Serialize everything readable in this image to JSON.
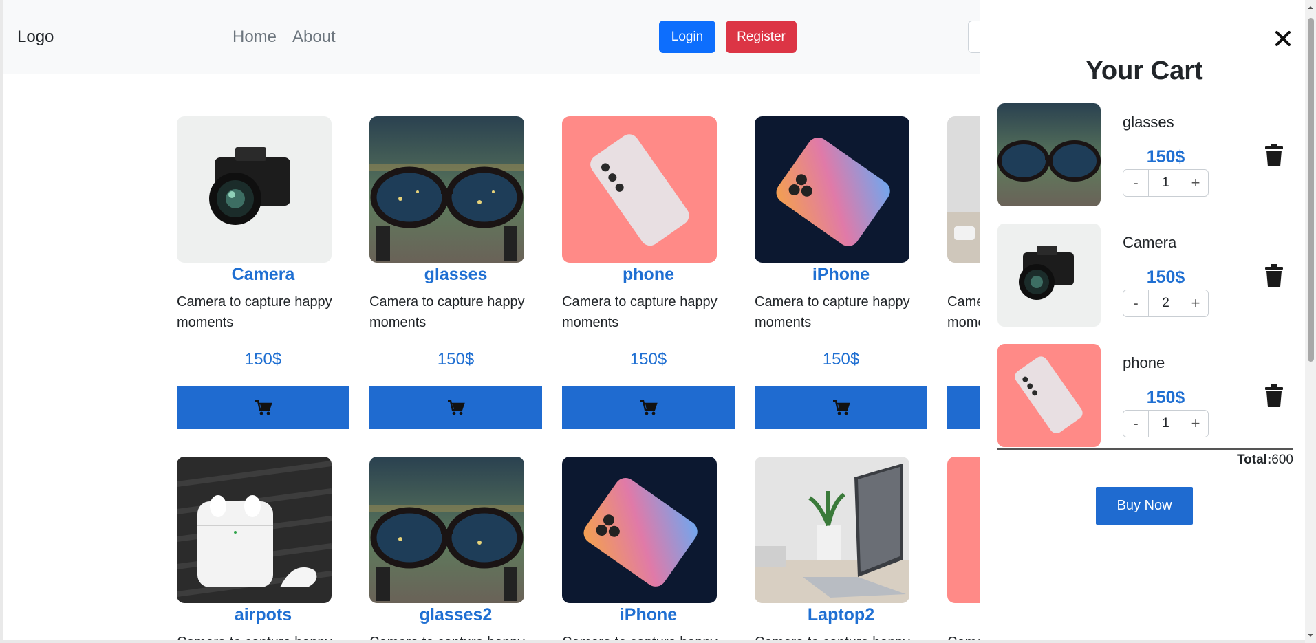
{
  "nav": {
    "logo": "Logo",
    "links": [
      "Home",
      "About"
    ],
    "login_label": "Login",
    "register_label": "Register"
  },
  "products": [
    {
      "name": "Camera",
      "desc": "Camera to capture happy moments",
      "price": "150$",
      "image": "camera"
    },
    {
      "name": "glasses",
      "desc": "Camera to capture happy moments",
      "price": "150$",
      "image": "glasses"
    },
    {
      "name": "phone",
      "desc": "Camera to capture happy moments",
      "price": "150$",
      "image": "phone-pink"
    },
    {
      "name": "iPhone",
      "desc": "Camera to capture happy moments",
      "price": "150$",
      "image": "iphone"
    },
    {
      "name": "",
      "desc": "Camera to capture happy moments",
      "price": "",
      "image": "laptop"
    },
    {
      "name": "airpots",
      "desc": "Camera to capture happy",
      "price": "",
      "image": "airpods"
    },
    {
      "name": "glasses2",
      "desc": "Camera to capture happy",
      "price": "",
      "image": "glasses"
    },
    {
      "name": "iPhone",
      "desc": "Camera to capture happy",
      "price": "",
      "image": "iphone"
    },
    {
      "name": "Laptop2",
      "desc": "Camera to capture happy",
      "price": "",
      "image": "laptop"
    },
    {
      "name": "",
      "desc": "Camera to capture happy",
      "price": "",
      "image": "phone-pink"
    }
  ],
  "cart": {
    "title": "Your Cart",
    "items": [
      {
        "name": "glasses",
        "price": "150$",
        "qty": "1",
        "image": "glasses"
      },
      {
        "name": "Camera",
        "price": "150$",
        "qty": "2",
        "image": "camera"
      },
      {
        "name": "phone",
        "price": "150$",
        "qty": "1",
        "image": "phone-pink"
      }
    ],
    "total_label": "Total:",
    "total_value": "600",
    "buy_label": "Buy Now"
  },
  "icons": {
    "cart": "shopping-cart-icon",
    "close": "close-icon",
    "trash": "trash-icon"
  },
  "colors": {
    "primary": "#1f6bd0",
    "login": "#0d6efd",
    "register": "#dc3545",
    "link_text": "#1f6fd2"
  }
}
